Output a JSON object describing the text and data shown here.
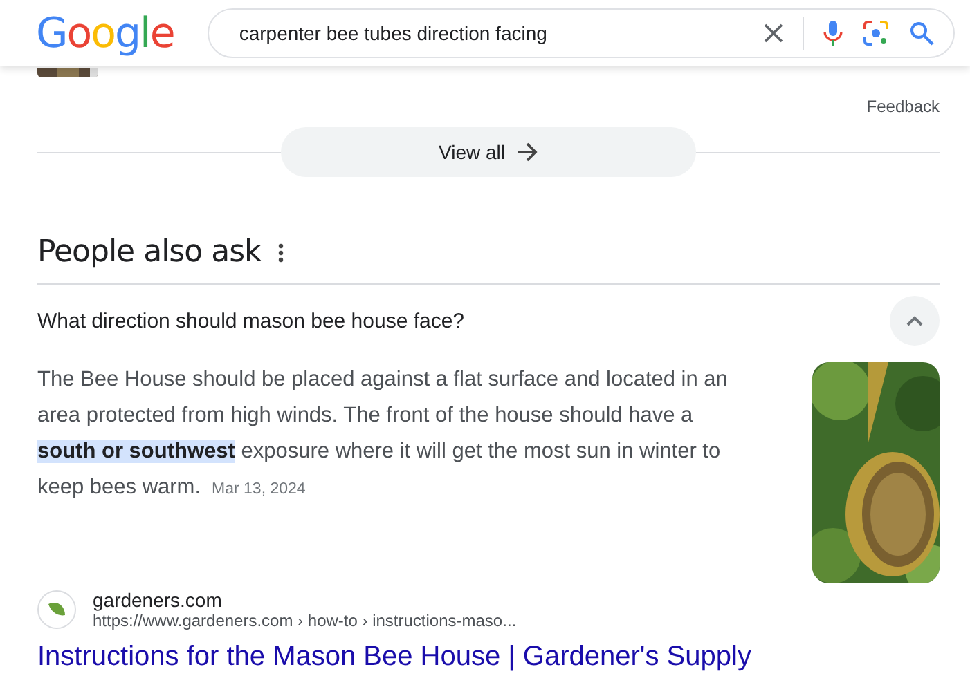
{
  "header": {
    "logo": "Google",
    "search": {
      "value": "carpenter bee tubes direction facing"
    }
  },
  "feedback": "Feedback",
  "view_all": {
    "label": "View all"
  },
  "people_also_ask": {
    "title": "People also ask",
    "questions": [
      {
        "question": "What direction should mason bee house face?",
        "expanded": true,
        "answer": "The Bee House should be placed against a flat surface and located in an area protected from high winds. The front of the house should have a **south or southwest** exposure where it will get the most sun in winter to keep bees warm.",
        "date": "Mar 13, 2024",
        "source": {
          "site": "gardeners.com",
          "url": "https://www.gardeners.com › how-to › instructions-maso...",
          "title": "Instructions for the Mason Bee House | Gardener's Supply"
        }
      }
    ]
  }
}
